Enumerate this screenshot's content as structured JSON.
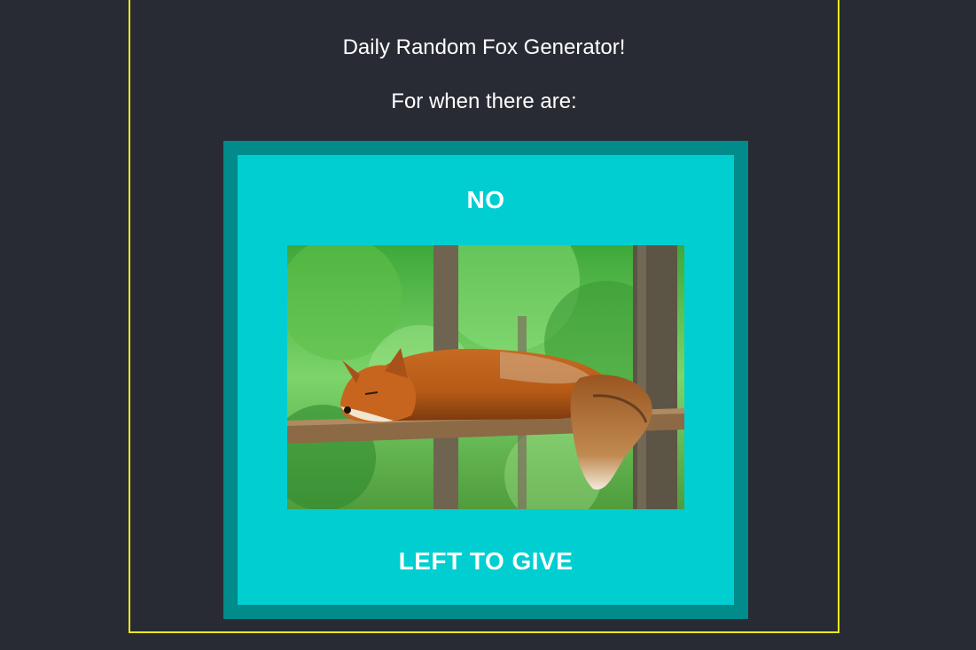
{
  "header": {
    "title": "Daily Random Fox Generator!",
    "subtitle": "For when there are:"
  },
  "card": {
    "top_label": "NO",
    "bottom_label": "LEFT TO GIVE",
    "image_alt": "fox"
  },
  "colors": {
    "background": "#282b33",
    "frame_border": "#f4ea1a",
    "card_outer": "#018b8a",
    "card_inner": "#00ced1",
    "text": "#ffffff"
  }
}
